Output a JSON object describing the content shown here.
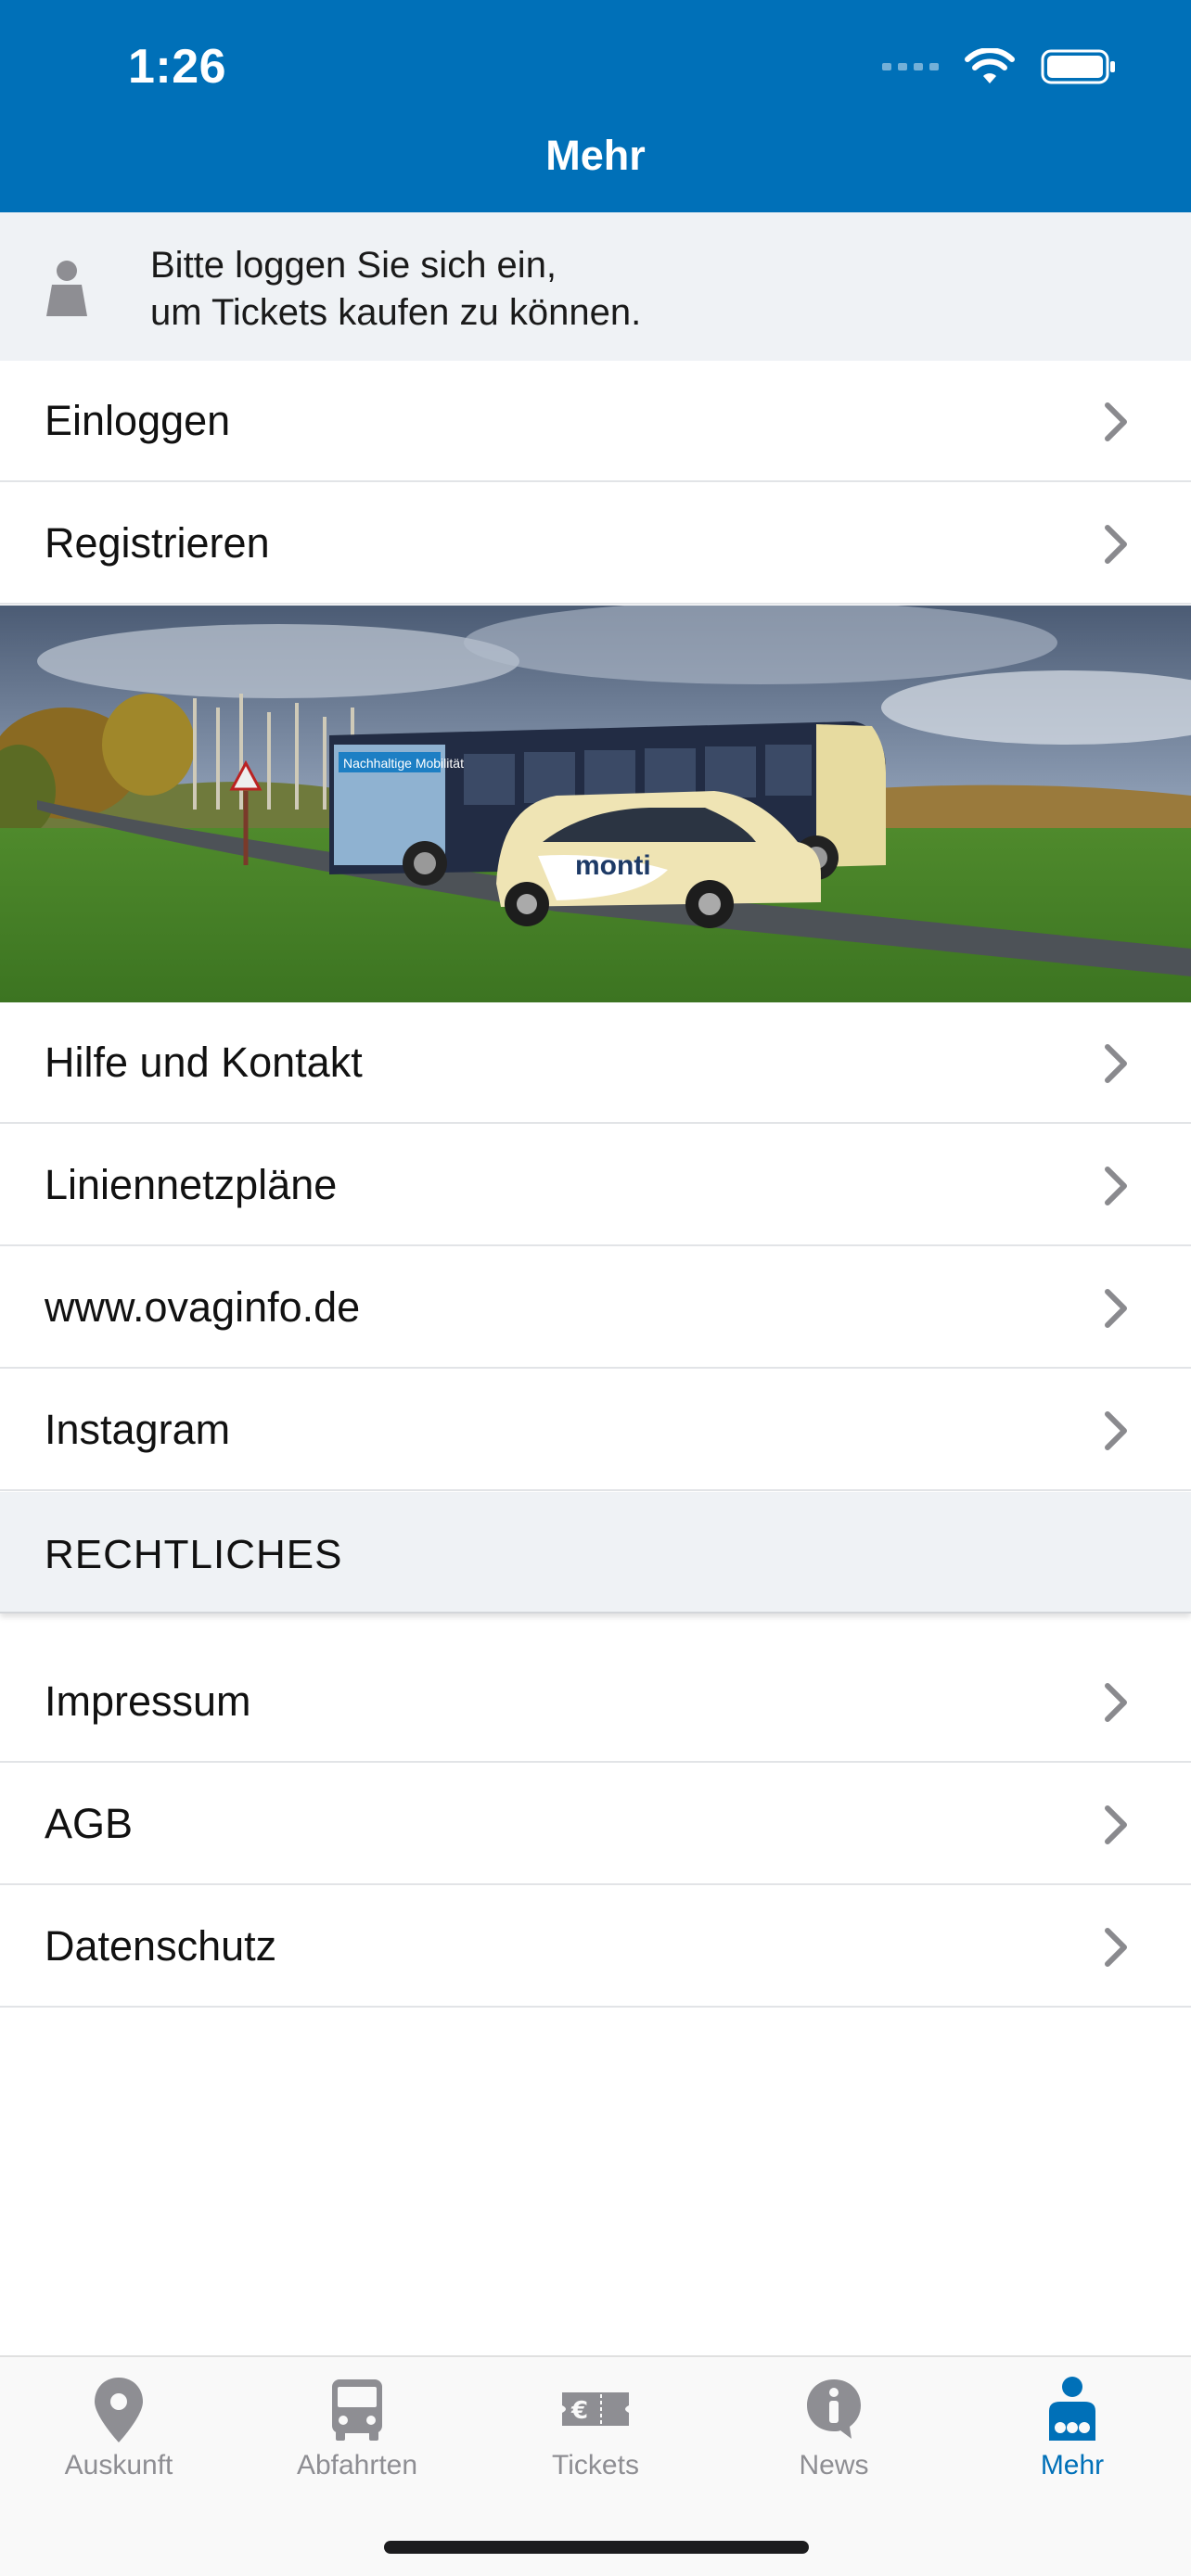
{
  "status_bar": {
    "time": "1:26"
  },
  "header": {
    "title": "Mehr"
  },
  "login_banner": {
    "line1": "Bitte loggen Sie sich ein,",
    "line2": "um Tickets kaufen zu können."
  },
  "account_items": [
    {
      "label": "Einloggen"
    },
    {
      "label": "Registrieren"
    }
  ],
  "hero": {
    "bus_banner_text": "Nachhaltige Mobilität?",
    "car_brand": "monti"
  },
  "info_items": [
    {
      "label": "Hilfe und Kontakt"
    },
    {
      "label": "Liniennetzpläne"
    },
    {
      "label": "www.ovaginfo.de"
    },
    {
      "label": "Instagram"
    }
  ],
  "legal_section": {
    "title": "RECHTLICHES",
    "items": [
      {
        "label": "Impressum"
      },
      {
        "label": "AGB"
      },
      {
        "label": "Datenschutz"
      }
    ]
  },
  "tabbar": {
    "active_color": "#0070b8",
    "inactive_color": "#8e8e93",
    "tabs": [
      {
        "label": "Auskunft",
        "icon": "location-pin-icon"
      },
      {
        "label": "Abfahrten",
        "icon": "bus-icon"
      },
      {
        "label": "Tickets",
        "icon": "ticket-icon"
      },
      {
        "label": "News",
        "icon": "info-icon"
      },
      {
        "label": "Mehr",
        "icon": "people-icon"
      }
    ]
  },
  "colors": {
    "header": "#0070b8",
    "banner_bg": "#eff2f5",
    "chevron": "#8a8a8e"
  }
}
